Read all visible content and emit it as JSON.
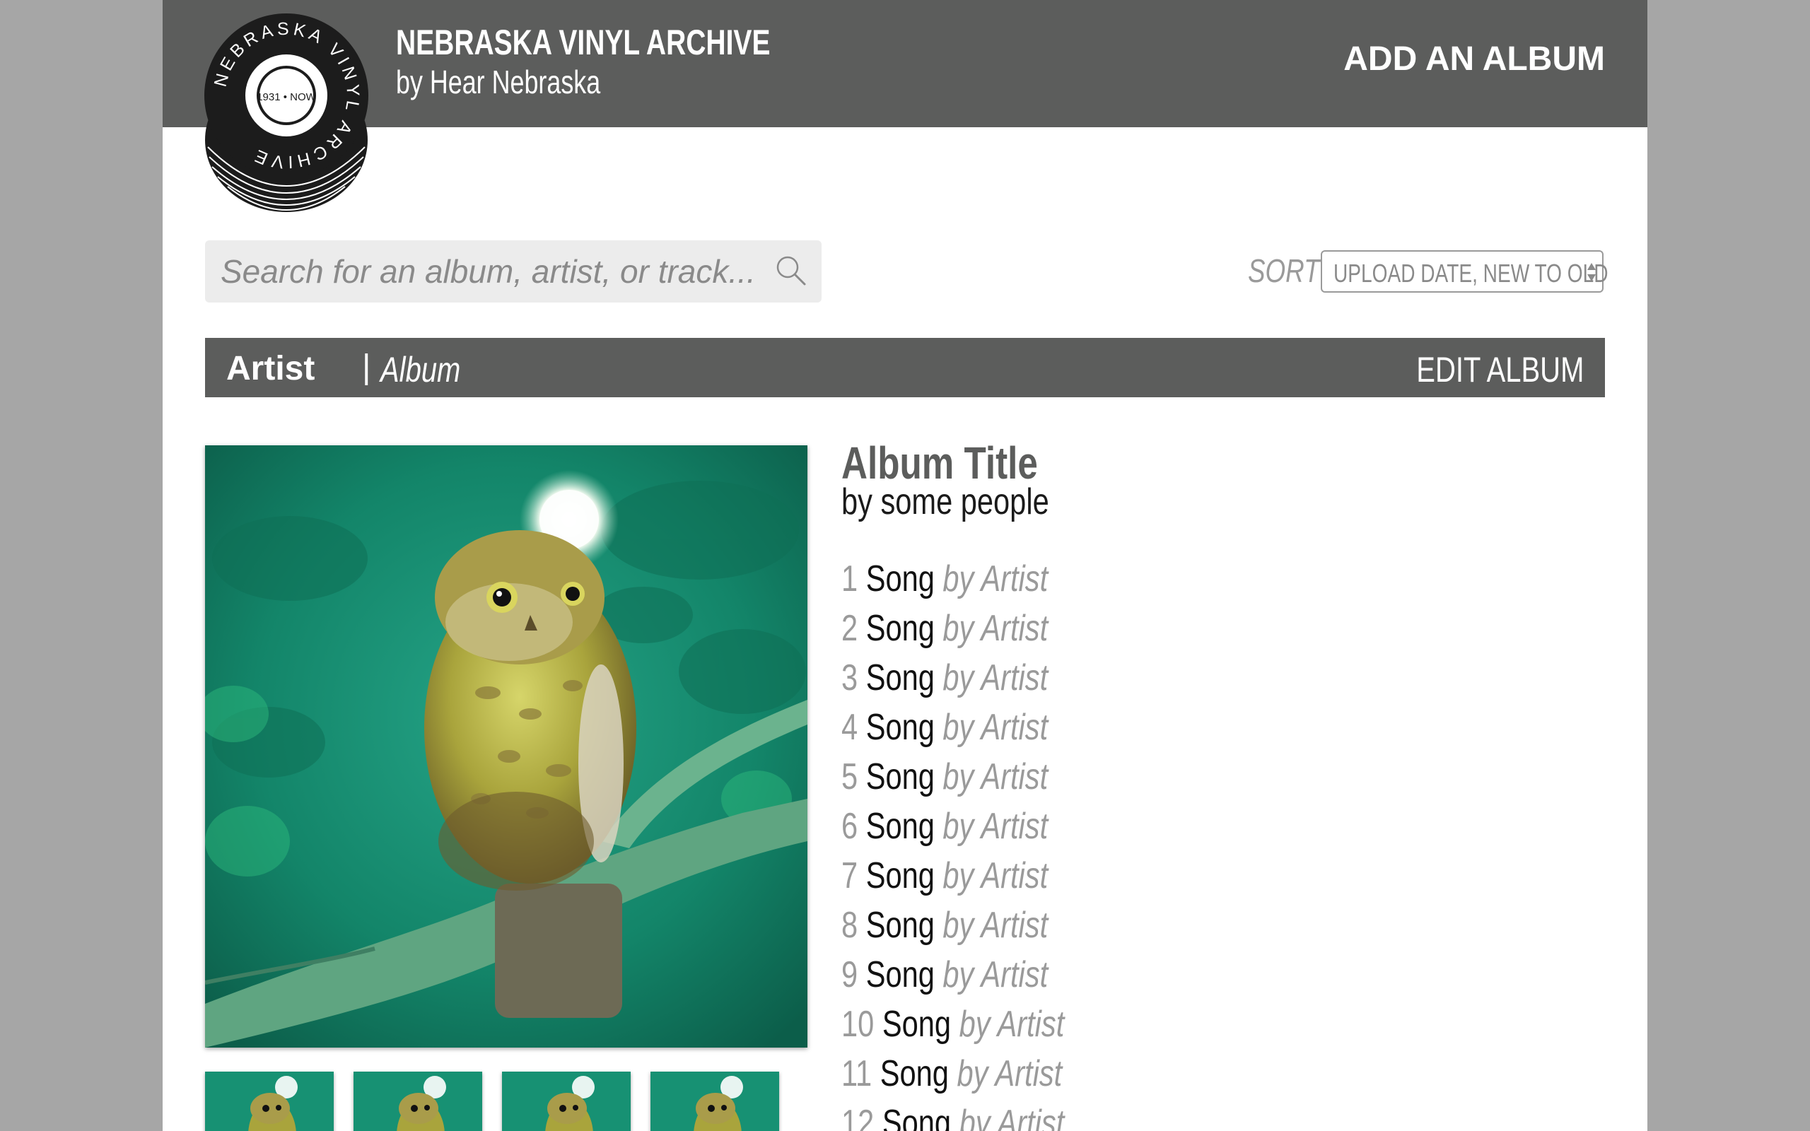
{
  "header": {
    "title": "NEBRASKA VINYL ARCHIVE",
    "subtitle": "by Hear Nebraska",
    "add_album_label": "ADD AN ALBUM",
    "logo": {
      "ring_text": "NEBRASKA VINYL ARCHIVE",
      "center_text": "1931 • NOW"
    }
  },
  "search": {
    "placeholder": "Search for an album, artist, or track...",
    "value": "",
    "icon": "search-icon"
  },
  "sort": {
    "label": "SORT",
    "selected": "UPLOAD DATE, NEW TO OLD"
  },
  "album_bar": {
    "artist": "Artist",
    "separator": "|",
    "album": "Album",
    "edit_label": "EDIT ALBUM"
  },
  "album": {
    "title": "Album Title",
    "byline": "by some people",
    "tracks": [
      {
        "num": "1",
        "title": "Song",
        "artist": "by Artist"
      },
      {
        "num": "2",
        "title": "Song",
        "artist": "by Artist"
      },
      {
        "num": "3",
        "title": "Song",
        "artist": "by Artist"
      },
      {
        "num": "4",
        "title": "Song",
        "artist": "by Artist"
      },
      {
        "num": "5",
        "title": "Song",
        "artist": "by Artist"
      },
      {
        "num": "6",
        "title": "Song",
        "artist": "by Artist"
      },
      {
        "num": "7",
        "title": "Song",
        "artist": "by Artist"
      },
      {
        "num": "8",
        "title": "Song",
        "artist": "by Artist"
      },
      {
        "num": "9",
        "title": "Song",
        "artist": "by Artist"
      },
      {
        "num": "10",
        "title": "Song",
        "artist": "by Artist"
      },
      {
        "num": "11",
        "title": "Song",
        "artist": "by Artist"
      },
      {
        "num": "12",
        "title": "Song",
        "artist": "by Artist"
      }
    ]
  },
  "colors": {
    "header_bg": "#5c5d5c",
    "page_bg": "#a6a6a6",
    "cover_green": "#1a8a6e"
  }
}
